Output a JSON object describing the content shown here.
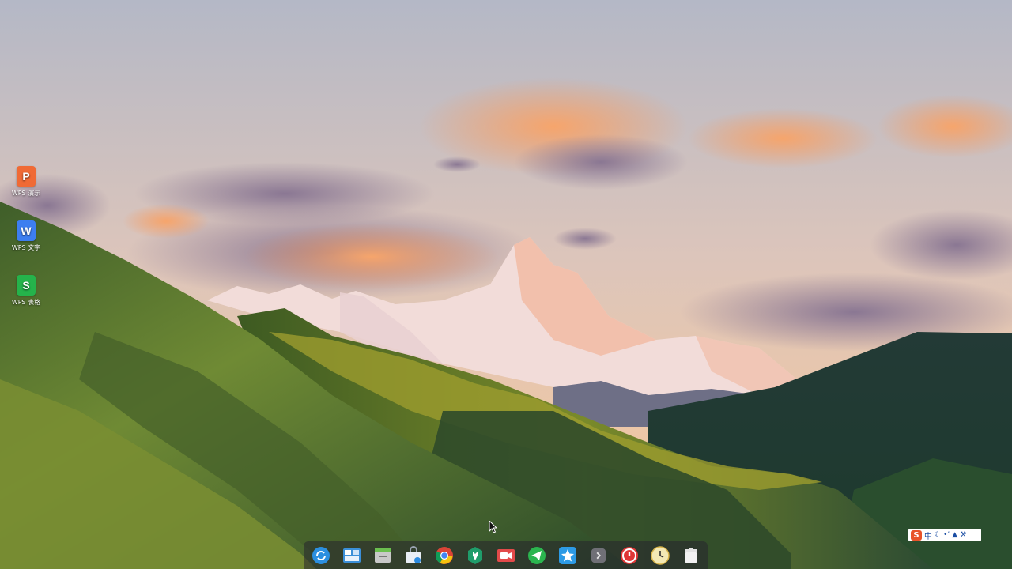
{
  "desktop": {
    "icons": [
      {
        "label": "WPS 演示",
        "glyph": "P",
        "color": "#f06a35",
        "icon": "wps-presentation-icon"
      },
      {
        "label": "WPS 文字",
        "glyph": "W",
        "color": "#3d7ef0",
        "icon": "wps-writer-icon"
      },
      {
        "label": "WPS 表格",
        "glyph": "S",
        "color": "#25b34b",
        "icon": "wps-spreadsheet-icon"
      }
    ]
  },
  "dock": {
    "items": [
      {
        "name": "launcher",
        "icon": "launcher-icon"
      },
      {
        "name": "multitask-view",
        "icon": "multitask-icon"
      },
      {
        "name": "file-manager",
        "icon": "folder-icon"
      },
      {
        "name": "app-store",
        "icon": "store-icon"
      },
      {
        "name": "chrome",
        "icon": "chrome-icon"
      },
      {
        "name": "system-tools",
        "icon": "wrench-icon"
      },
      {
        "name": "screen-recorder",
        "icon": "video-icon"
      },
      {
        "name": "telegram",
        "icon": "telegram-icon"
      },
      {
        "name": "star-app",
        "icon": "star-icon"
      },
      {
        "name": "show-more",
        "icon": "chevron-right-icon"
      },
      {
        "name": "power",
        "icon": "power-icon"
      },
      {
        "name": "clock",
        "icon": "clock-icon"
      },
      {
        "name": "trash",
        "icon": "trash-icon"
      }
    ]
  },
  "ime": {
    "logo": "S",
    "mode": "中",
    "icons": [
      "moon-icon",
      "punctuation-icon",
      "shirt-icon",
      "wrench-icon"
    ]
  },
  "colors": {
    "sky_top": "#b8bcc8",
    "sky_bottom": "#e8c3a8",
    "cloud_orange": "#f39a63",
    "cloud_purple": "#8f7d96",
    "snow": "#f3dfdb",
    "hill_green": "#5e7b2f",
    "hill_dark": "#233a2e",
    "dock_bg": "#26242e",
    "ime_accent": "#e8532a"
  }
}
